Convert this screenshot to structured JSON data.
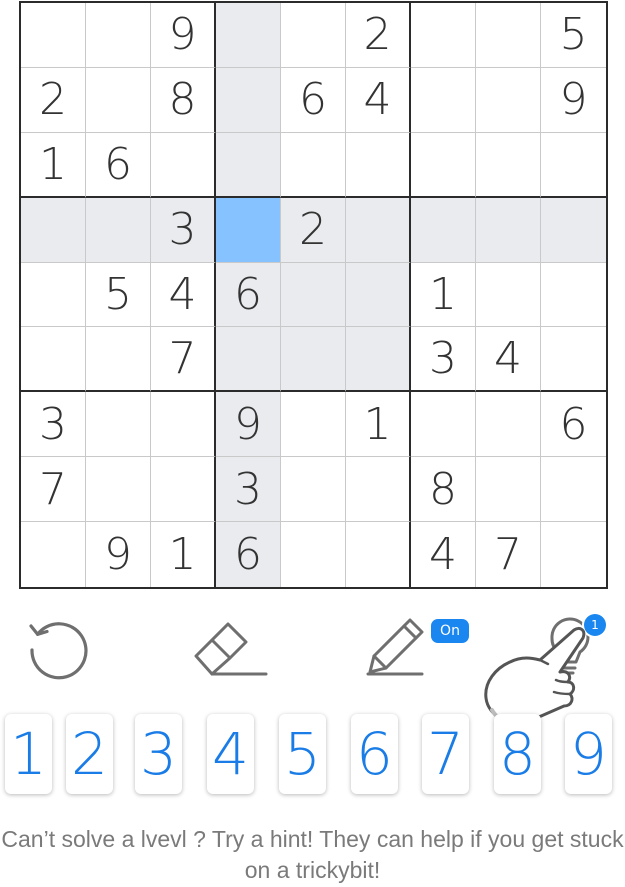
{
  "board": [
    [
      "",
      "",
      "9",
      "",
      "",
      "2",
      "",
      "",
      "5"
    ],
    [
      "2",
      "",
      "8",
      "",
      "6",
      "4",
      "",
      "",
      "9"
    ],
    [
      "1",
      "6",
      "",
      "",
      "",
      "",
      "",
      "",
      ""
    ],
    [
      "",
      "",
      "3",
      "",
      "2",
      "",
      "",
      "",
      ""
    ],
    [
      "",
      "5",
      "4",
      "6",
      "",
      "",
      "1",
      "",
      ""
    ],
    [
      "",
      "",
      "7",
      "",
      "",
      "",
      "3",
      "4",
      ""
    ],
    [
      "3",
      "",
      "",
      "9",
      "",
      "1",
      "",
      "",
      "6"
    ],
    [
      "7",
      "",
      "",
      "3",
      "",
      "",
      "8",
      "",
      ""
    ],
    [
      "",
      "9",
      "1",
      "6",
      "",
      "",
      "4",
      "7",
      ""
    ]
  ],
  "selected_cell": {
    "row": 3,
    "col": 3
  },
  "toolbar": {
    "undo_icon": "undo-icon",
    "erase_icon": "eraser-icon",
    "notes_icon": "pencil-icon",
    "notes_badge": "On",
    "hint_icon": "lightbulb-icon",
    "hint_badge": "1"
  },
  "number_pad": [
    "1",
    "2",
    "3",
    "4",
    "5",
    "6",
    "7",
    "8",
    "9"
  ],
  "tutorial": {
    "pointer_icon": "pointing-hand-icon",
    "text": "Can’t solve a lvevl ? Try a hint! They can help if you get stuck on a trickybit!"
  },
  "colors": {
    "accent": "#1a86f0",
    "selected_cell": "#86c2ff",
    "highlight": "#e9ebee",
    "given_digit": "#333333"
  }
}
